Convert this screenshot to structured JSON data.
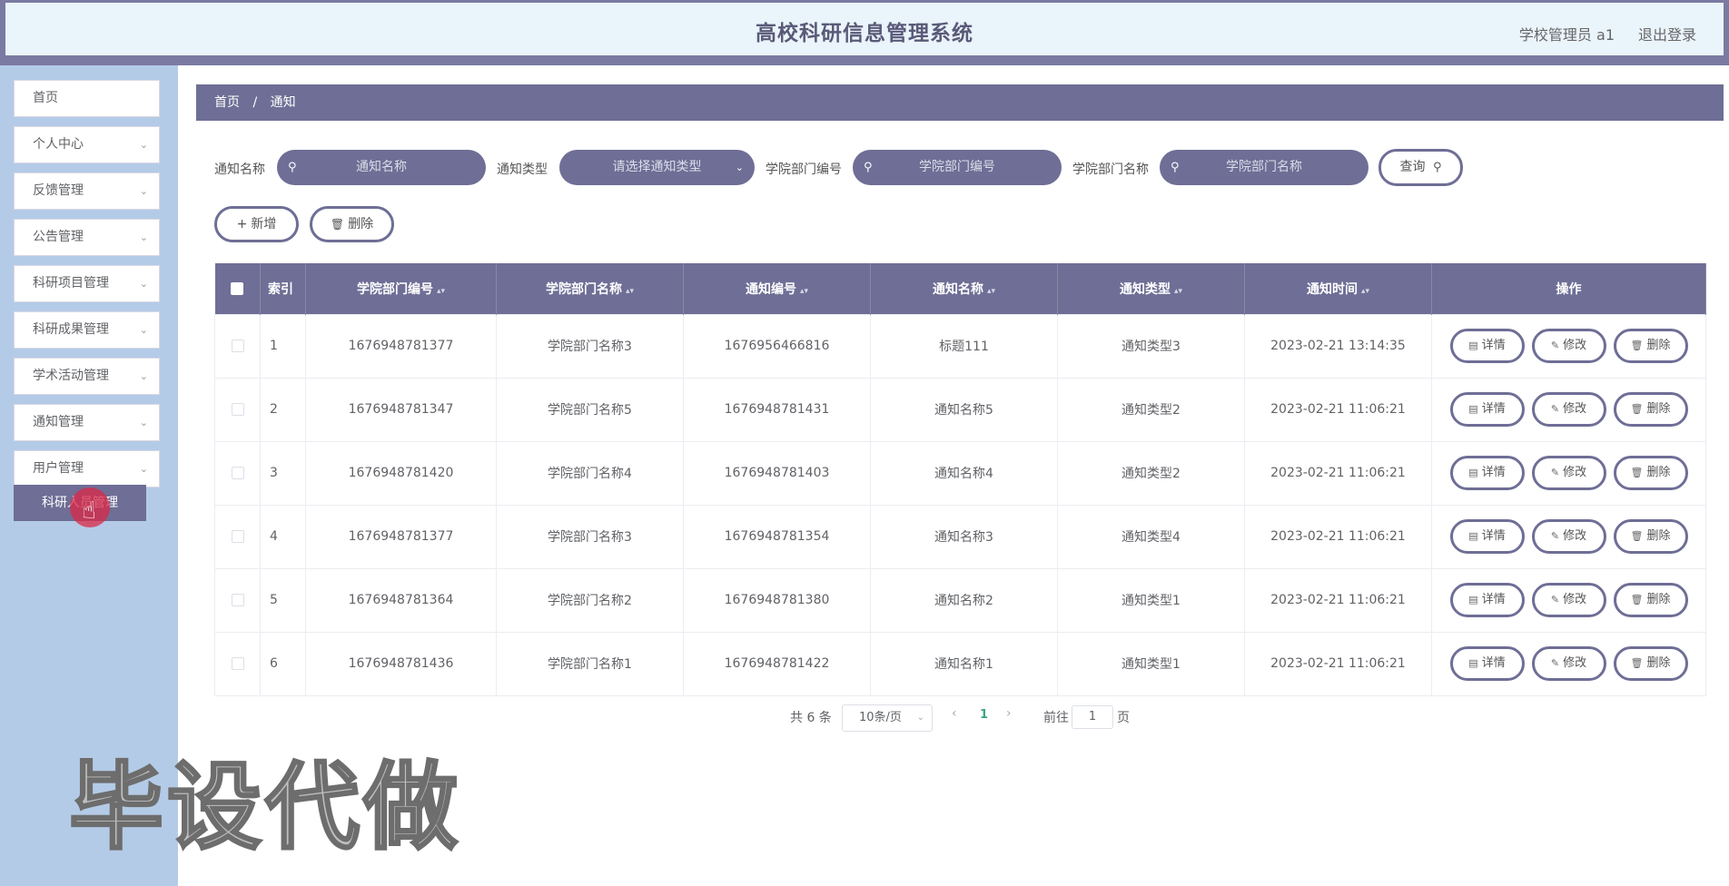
{
  "header": {
    "title": "高校科研信息管理系统",
    "user": "学校管理员 a1",
    "logout": "退出登录"
  },
  "sidebar": {
    "items": [
      {
        "label": "首页",
        "has_chevron": false
      },
      {
        "label": "个人中心",
        "has_chevron": true
      },
      {
        "label": "反馈管理",
        "has_chevron": true
      },
      {
        "label": "公告管理",
        "has_chevron": true
      },
      {
        "label": "科研项目管理",
        "has_chevron": true
      },
      {
        "label": "科研成果管理",
        "has_chevron": true
      },
      {
        "label": "学术活动管理",
        "has_chevron": true
      },
      {
        "label": "通知管理",
        "has_chevron": true
      },
      {
        "label": "用户管理",
        "has_chevron": true
      }
    ],
    "open_submenu": {
      "label": "科研人员管理"
    }
  },
  "watermark": "毕设代做",
  "breadcrumb": {
    "home": "首页",
    "separator": "/",
    "current": "通知"
  },
  "search": {
    "fields": [
      {
        "label": "通知名称",
        "placeholder": "通知名称",
        "kind": "input"
      },
      {
        "label": "通知类型",
        "placeholder": "请选择通知类型",
        "kind": "select"
      },
      {
        "label": "学院部门编号",
        "placeholder": "学院部门编号",
        "kind": "input"
      },
      {
        "label": "学院部门名称",
        "placeholder": "学院部门名称",
        "kind": "input"
      }
    ],
    "query_label": "查询"
  },
  "actions": {
    "add_label": "新增",
    "delete_label": "删除"
  },
  "table": {
    "columns": [
      "索引",
      "学院部门编号",
      "学院部门名称",
      "通知编号",
      "通知名称",
      "通知类型",
      "通知时间",
      "操作"
    ],
    "rows": [
      {
        "index": "1",
        "dept_no": "1676948781377",
        "dept_name": "学院部门名称3",
        "notice_no": "1676956466816",
        "notice_name": "标题111",
        "notice_type": "通知类型3",
        "notice_time": "2023-02-21 13:14:35"
      },
      {
        "index": "2",
        "dept_no": "1676948781347",
        "dept_name": "学院部门名称5",
        "notice_no": "1676948781431",
        "notice_name": "通知名称5",
        "notice_type": "通知类型2",
        "notice_time": "2023-02-21 11:06:21"
      },
      {
        "index": "3",
        "dept_no": "1676948781420",
        "dept_name": "学院部门名称4",
        "notice_no": "1676948781403",
        "notice_name": "通知名称4",
        "notice_type": "通知类型2",
        "notice_time": "2023-02-21 11:06:21"
      },
      {
        "index": "4",
        "dept_no": "1676948781377",
        "dept_name": "学院部门名称3",
        "notice_no": "1676948781354",
        "notice_name": "通知名称3",
        "notice_type": "通知类型4",
        "notice_time": "2023-02-21 11:06:21"
      },
      {
        "index": "5",
        "dept_no": "1676948781364",
        "dept_name": "学院部门名称2",
        "notice_no": "1676948781380",
        "notice_name": "通知名称2",
        "notice_type": "通知类型1",
        "notice_time": "2023-02-21 11:06:21"
      },
      {
        "index": "6",
        "dept_no": "1676948781436",
        "dept_name": "学院部门名称1",
        "notice_no": "1676948781422",
        "notice_name": "通知名称1",
        "notice_type": "通知类型1",
        "notice_time": "2023-02-21 11:06:21"
      }
    ],
    "row_actions": {
      "detail": "详情",
      "edit": "修改",
      "delete": "删除"
    }
  },
  "pagination": {
    "total": "共 6 条",
    "page_size": "10条/页",
    "current_page": "1",
    "goto_label": "前往",
    "goto_value": "1",
    "page_unit": "页"
  },
  "colors": {
    "accent": "#6e6e96",
    "sidebar_bg": "#b4cbe7",
    "header_bg": "#eaf4fb",
    "active_page": "#3aa57e"
  }
}
